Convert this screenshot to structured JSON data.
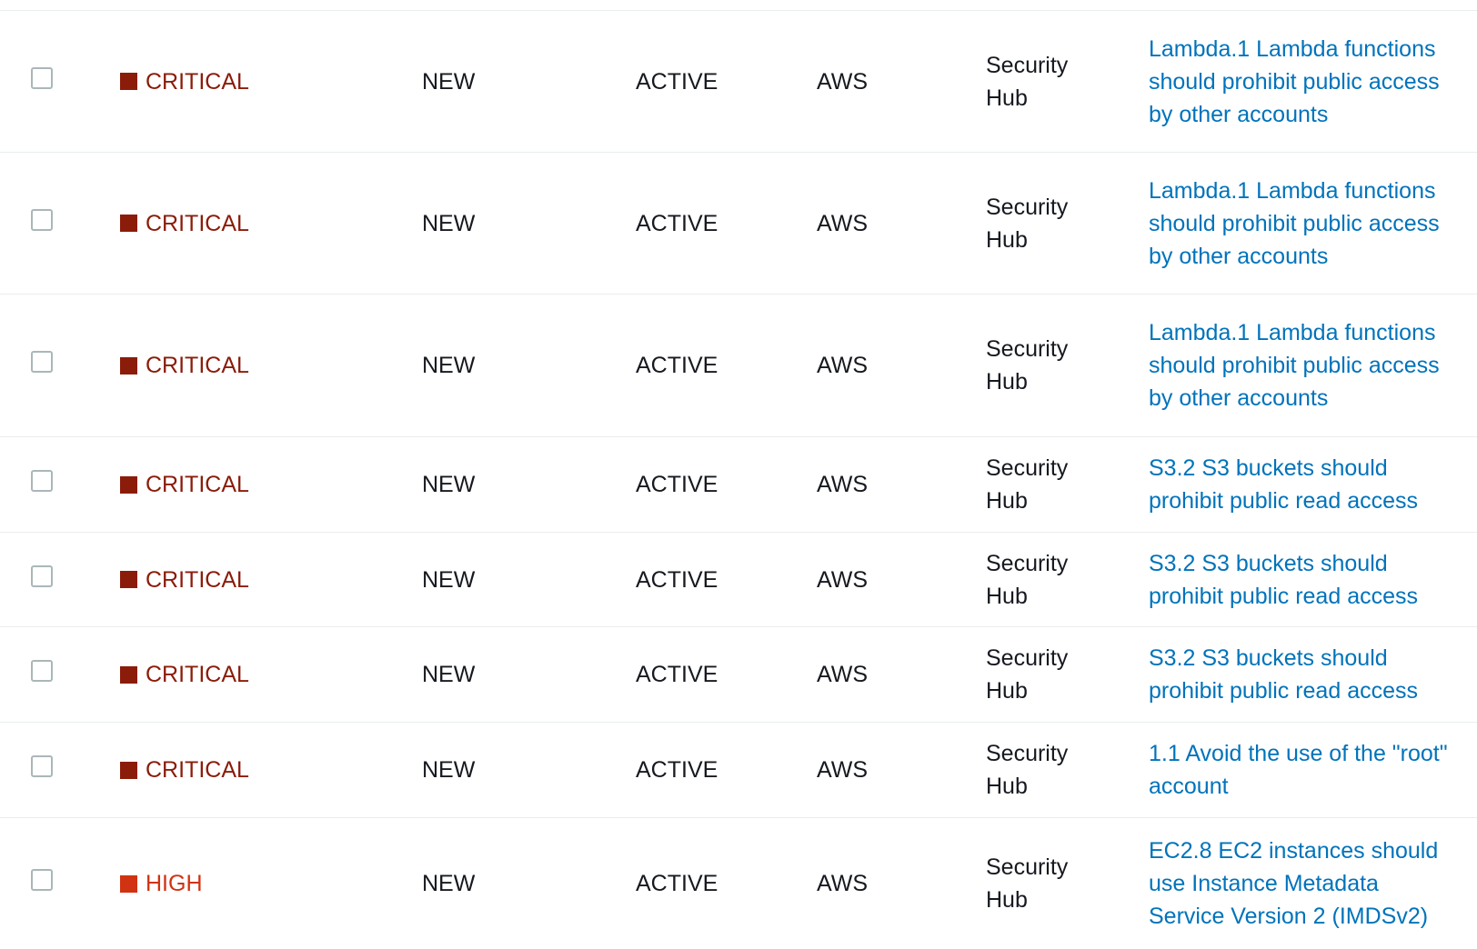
{
  "colors": {
    "critical": "#8b1c0a",
    "high": "#d13212",
    "link": "#0073bb",
    "text": "#16191f",
    "border": "#eaeded"
  },
  "findings": [
    {
      "severity": "CRITICAL",
      "workflow": "NEW",
      "record": "ACTIVE",
      "company": "AWS",
      "product": "Security Hub",
      "title": "Lambda.1 Lambda functions should prohibit public access by other accounts"
    },
    {
      "severity": "CRITICAL",
      "workflow": "NEW",
      "record": "ACTIVE",
      "company": "AWS",
      "product": "Security Hub",
      "title": "Lambda.1 Lambda functions should prohibit public access by other accounts"
    },
    {
      "severity": "CRITICAL",
      "workflow": "NEW",
      "record": "ACTIVE",
      "company": "AWS",
      "product": "Security Hub",
      "title": "Lambda.1 Lambda functions should prohibit public access by other accounts"
    },
    {
      "severity": "CRITICAL",
      "workflow": "NEW",
      "record": "ACTIVE",
      "company": "AWS",
      "product": "Security Hub",
      "title": "S3.2 S3 buckets should prohibit public read access"
    },
    {
      "severity": "CRITICAL",
      "workflow": "NEW",
      "record": "ACTIVE",
      "company": "AWS",
      "product": "Security Hub",
      "title": "S3.2 S3 buckets should prohibit public read access"
    },
    {
      "severity": "CRITICAL",
      "workflow": "NEW",
      "record": "ACTIVE",
      "company": "AWS",
      "product": "Security Hub",
      "title": "S3.2 S3 buckets should prohibit public read access"
    },
    {
      "severity": "CRITICAL",
      "workflow": "NEW",
      "record": "ACTIVE",
      "company": "AWS",
      "product": "Security Hub",
      "title": "1.1 Avoid the use of the \"root\" account"
    },
    {
      "severity": "HIGH",
      "workflow": "NEW",
      "record": "ACTIVE",
      "company": "AWS",
      "product": "Security Hub",
      "title": "EC2.8 EC2 instances should use Instance Metadata Service Version 2 (IMDSv2)"
    }
  ]
}
